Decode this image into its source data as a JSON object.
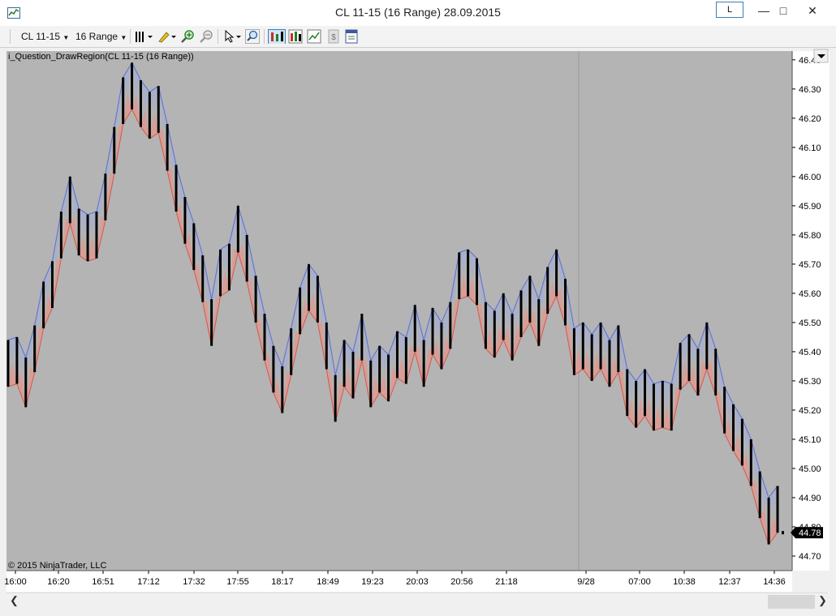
{
  "window": {
    "title": "CL 11-15 (16 Range)  28.09.2015",
    "link_button": "L",
    "minimize": "—",
    "maximize": "□",
    "close": "✕"
  },
  "toolbar": {
    "instrument": "CL 11-15",
    "period": "16 Range",
    "icons": [
      "bar-type-icon",
      "pencil-draw-icon",
      "zoom-in-icon",
      "zoom-out-icon",
      "pointer-icon",
      "magnifier-icon",
      "chart-style-icon",
      "data-box-icon",
      "indicators-icon",
      "strategies-icon",
      "properties-icon"
    ]
  },
  "chart": {
    "indicator_label": "i_Question_DrawRegion(CL 11-15 (16 Range))",
    "copyright": "© 2015 NinjaTrader, LLC",
    "last_price": "44.78",
    "colors": {
      "background": "#b4b4b4",
      "region_up": "#a9b0c8",
      "region_down": "#d79e96",
      "line_up": "#5a6fd0",
      "line_down": "#d05a50",
      "bar": "#000000"
    }
  },
  "chart_data": {
    "type": "bar",
    "ylim": [
      44.65,
      46.43
    ],
    "y_ticks": [
      "46.40",
      "46.30",
      "46.20",
      "46.10",
      "46.00",
      "45.90",
      "45.80",
      "45.70",
      "45.60",
      "45.50",
      "45.40",
      "45.30",
      "45.20",
      "45.10",
      "45.00",
      "44.90",
      "44.80",
      "44.70"
    ],
    "x_ticks": [
      "16:00",
      "16:20",
      "16:51",
      "17:12",
      "17:32",
      "17:55",
      "18:17",
      "18:49",
      "19:23",
      "20:03",
      "20:56",
      "21:18",
      "9/28",
      "07:00",
      "10:38",
      "12:37",
      "14:36"
    ],
    "bars": [
      {
        "high": 45.44,
        "low": 45.28
      },
      {
        "high": 45.45,
        "low": 45.29
      },
      {
        "high": 45.38,
        "low": 45.21
      },
      {
        "high": 45.49,
        "low": 45.33
      },
      {
        "high": 45.64,
        "low": 45.48
      },
      {
        "high": 45.71,
        "low": 45.55
      },
      {
        "high": 45.88,
        "low": 45.72
      },
      {
        "high": 46.0,
        "low": 45.84
      },
      {
        "high": 45.89,
        "low": 45.73
      },
      {
        "high": 45.87,
        "low": 45.71
      },
      {
        "high": 45.88,
        "low": 45.72
      },
      {
        "high": 46.01,
        "low": 45.85
      },
      {
        "high": 46.17,
        "low": 46.01
      },
      {
        "high": 46.34,
        "low": 46.18
      },
      {
        "high": 46.39,
        "low": 46.23
      },
      {
        "high": 46.33,
        "low": 46.17
      },
      {
        "high": 46.29,
        "low": 46.13
      },
      {
        "high": 46.31,
        "low": 46.15
      },
      {
        "high": 46.18,
        "low": 46.02
      },
      {
        "high": 46.04,
        "low": 45.88
      },
      {
        "high": 45.93,
        "low": 45.77
      },
      {
        "high": 45.84,
        "low": 45.68
      },
      {
        "high": 45.73,
        "low": 45.57
      },
      {
        "high": 45.58,
        "low": 45.42
      },
      {
        "high": 45.75,
        "low": 45.59
      },
      {
        "high": 45.77,
        "low": 45.61
      },
      {
        "high": 45.9,
        "low": 45.74
      },
      {
        "high": 45.8,
        "low": 45.64
      },
      {
        "high": 45.66,
        "low": 45.5
      },
      {
        "high": 45.53,
        "low": 45.37
      },
      {
        "high": 45.42,
        "low": 45.26
      },
      {
        "high": 45.35,
        "low": 45.19
      },
      {
        "high": 45.48,
        "low": 45.32
      },
      {
        "high": 45.62,
        "low": 45.46
      },
      {
        "high": 45.7,
        "low": 45.54
      },
      {
        "high": 45.66,
        "low": 45.5
      },
      {
        "high": 45.5,
        "low": 45.34
      },
      {
        "high": 45.32,
        "low": 45.16
      },
      {
        "high": 45.44,
        "low": 45.28
      },
      {
        "high": 45.4,
        "low": 45.24
      },
      {
        "high": 45.53,
        "low": 45.37
      },
      {
        "high": 45.37,
        "low": 45.21
      },
      {
        "high": 45.42,
        "low": 45.26
      },
      {
        "high": 45.39,
        "low": 45.23
      },
      {
        "high": 45.47,
        "low": 45.31
      },
      {
        "high": 45.45,
        "low": 45.29
      },
      {
        "high": 45.56,
        "low": 45.4
      },
      {
        "high": 45.44,
        "low": 45.28
      },
      {
        "high": 45.55,
        "low": 45.39
      },
      {
        "high": 45.5,
        "low": 45.34
      },
      {
        "high": 45.57,
        "low": 45.41
      },
      {
        "high": 45.74,
        "low": 45.58
      },
      {
        "high": 45.75,
        "low": 45.59
      },
      {
        "high": 45.72,
        "low": 45.56
      },
      {
        "high": 45.57,
        "low": 45.41
      },
      {
        "high": 45.54,
        "low": 45.38
      },
      {
        "high": 45.6,
        "low": 45.44
      },
      {
        "high": 45.53,
        "low": 45.37
      },
      {
        "high": 45.61,
        "low": 45.45
      },
      {
        "high": 45.66,
        "low": 45.5
      },
      {
        "high": 45.58,
        "low": 45.42
      },
      {
        "high": 45.69,
        "low": 45.53
      },
      {
        "high": 45.75,
        "low": 45.59
      },
      {
        "high": 45.65,
        "low": 45.49
      },
      {
        "high": 45.48,
        "low": 45.32
      },
      {
        "high": 45.5,
        "low": 45.34
      },
      {
        "high": 45.46,
        "low": 45.3
      },
      {
        "high": 45.5,
        "low": 45.34
      },
      {
        "high": 45.44,
        "low": 45.28
      },
      {
        "high": 45.49,
        "low": 45.33
      },
      {
        "high": 45.34,
        "low": 45.18
      },
      {
        "high": 45.3,
        "low": 45.14
      },
      {
        "high": 45.34,
        "low": 45.18
      },
      {
        "high": 45.29,
        "low": 45.13
      },
      {
        "high": 45.3,
        "low": 45.14
      },
      {
        "high": 45.29,
        "low": 45.13
      },
      {
        "high": 45.43,
        "low": 45.27
      },
      {
        "high": 45.46,
        "low": 45.3
      },
      {
        "high": 45.41,
        "low": 45.25
      },
      {
        "high": 45.5,
        "low": 45.34
      },
      {
        "high": 45.41,
        "low": 45.25
      },
      {
        "high": 45.28,
        "low": 45.12
      },
      {
        "high": 45.22,
        "low": 45.06
      },
      {
        "high": 45.17,
        "low": 45.01
      },
      {
        "high": 45.1,
        "low": 44.94
      },
      {
        "high": 44.99,
        "low": 44.83
      },
      {
        "high": 44.9,
        "low": 44.74
      },
      {
        "high": 44.94,
        "low": 44.78
      }
    ]
  }
}
